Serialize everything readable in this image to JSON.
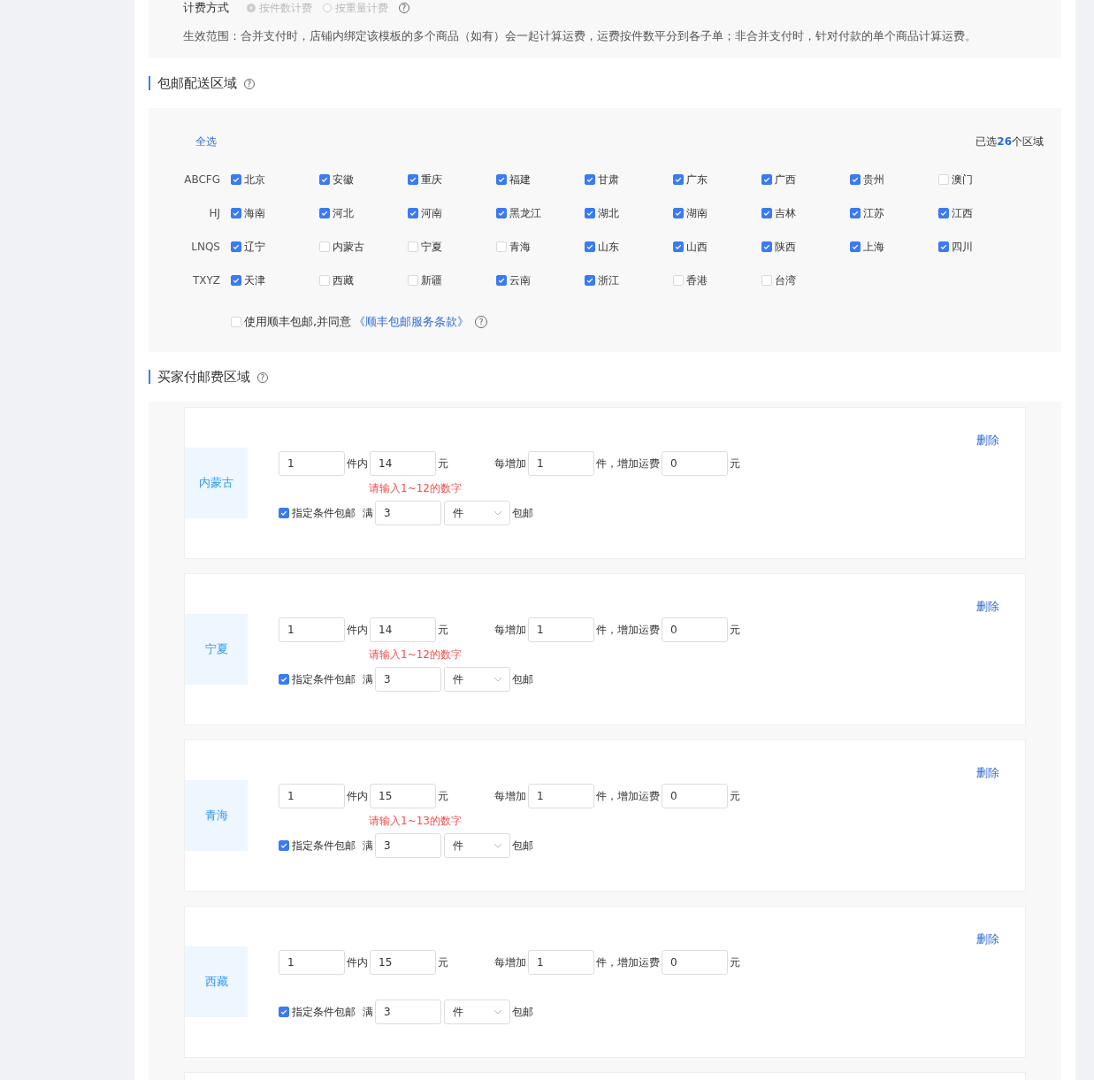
{
  "billing": {
    "label": "计费方式",
    "options": [
      {
        "label": "按件数计费",
        "selected": true,
        "disabled": true
      },
      {
        "label": "按重量计费",
        "selected": false,
        "disabled": true
      }
    ],
    "help": "?",
    "scope": "生效范围：合并支付时，店铺内绑定该模板的多个商品（如有）会一起计算运费，运费按件数平分到各子单；非合并支付时，针对付款的单个商品计算运费。"
  },
  "free_shipping": {
    "title": "包邮配送区域",
    "help": "?",
    "select_all": "全选",
    "selected_count": "已选**26**个区域",
    "groups": [
      {
        "letters": "ABCFG",
        "regions": [
          {
            "name": "北京",
            "checked": true
          },
          {
            "name": "安徽",
            "checked": true
          },
          {
            "name": "重庆",
            "checked": true
          },
          {
            "name": "福建",
            "checked": true
          },
          {
            "name": "甘肃",
            "checked": true
          },
          {
            "name": "广东",
            "checked": true
          },
          {
            "name": "广西",
            "checked": true
          },
          {
            "name": "贵州",
            "checked": true
          },
          {
            "name": "澳门",
            "checked": false
          }
        ]
      },
      {
        "letters": "HJ",
        "regions": [
          {
            "name": "海南",
            "checked": true
          },
          {
            "name": "河北",
            "checked": true
          },
          {
            "name": "河南",
            "checked": true
          },
          {
            "name": "黑龙江",
            "checked": true
          },
          {
            "name": "湖北",
            "checked": true
          },
          {
            "name": "湖南",
            "checked": true
          },
          {
            "name": "吉林",
            "checked": true
          },
          {
            "name": "江苏",
            "checked": true
          },
          {
            "name": "江西",
            "checked": true
          }
        ]
      },
      {
        "letters": "LNQS",
        "regions": [
          {
            "name": "辽宁",
            "checked": true
          },
          {
            "name": "内蒙古",
            "checked": false
          },
          {
            "name": "宁夏",
            "checked": false
          },
          {
            "name": "青海",
            "checked": false
          },
          {
            "name": "山东",
            "checked": true
          },
          {
            "name": "山西",
            "checked": true
          },
          {
            "name": "陕西",
            "checked": true
          },
          {
            "name": "上海",
            "checked": true
          },
          {
            "name": "四川",
            "checked": true
          }
        ]
      },
      {
        "letters": "TXYZ",
        "regions": [
          {
            "name": "天津",
            "checked": true
          },
          {
            "name": "西藏",
            "checked": false
          },
          {
            "name": "新疆",
            "checked": false
          },
          {
            "name": "云南",
            "checked": true
          },
          {
            "name": "浙江",
            "checked": true
          },
          {
            "name": "香港",
            "checked": false
          },
          {
            "name": "台湾",
            "checked": false
          }
        ]
      }
    ],
    "sf_option": {
      "checked": false,
      "text": "使用顺丰包邮,并同意",
      "link": "《顺丰包邮服务条款》",
      "help": "?"
    }
  },
  "paid_shipping": {
    "title": "买家付邮费区域",
    "help": "?",
    "zones": [
      {
        "region": "内蒙古",
        "delete": "删除",
        "first_count": "1",
        "first_label": "件内",
        "first_fee": "14",
        "yuan": "元",
        "add_label": "每增加",
        "add_count": "1",
        "add_fee_label": "件，增加运费",
        "add_fee": "0",
        "yuan2": "元",
        "error": "请输入1~12的数字",
        "condition": {
          "checked": true,
          "label": "指定条件包邮",
          "full": "满",
          "amount": "3",
          "unit": "件",
          "suffix": "包邮"
        }
      },
      {
        "region": "宁夏",
        "delete": "删除",
        "first_count": "1",
        "first_label": "件内",
        "first_fee": "14",
        "yuan": "元",
        "add_label": "每增加",
        "add_count": "1",
        "add_fee_label": "件，增加运费",
        "add_fee": "0",
        "yuan2": "元",
        "error": "请输入1~12的数字",
        "condition": {
          "checked": true,
          "label": "指定条件包邮",
          "full": "满",
          "amount": "3",
          "unit": "件",
          "suffix": "包邮"
        }
      },
      {
        "region": "青海",
        "delete": "删除",
        "first_count": "1",
        "first_label": "件内",
        "first_fee": "15",
        "yuan": "元",
        "add_label": "每增加",
        "add_count": "1",
        "add_fee_label": "件，增加运费",
        "add_fee": "0",
        "yuan2": "元",
        "error": "请输入1~13的数字",
        "condition": {
          "checked": true,
          "label": "指定条件包邮",
          "full": "满",
          "amount": "3",
          "unit": "件",
          "suffix": "包邮"
        }
      },
      {
        "region": "西藏",
        "delete": "删除",
        "first_count": "1",
        "first_label": "件内",
        "first_fee": "15",
        "yuan": "元",
        "add_label": "每增加",
        "add_count": "1",
        "add_fee_label": "件，增加运费",
        "add_fee": "0",
        "yuan2": "元",
        "condition": {
          "checked": true,
          "label": "指定条件包邮",
          "full": "满",
          "amount": "3",
          "unit": "件",
          "suffix": "包邮"
        }
      }
    ]
  }
}
